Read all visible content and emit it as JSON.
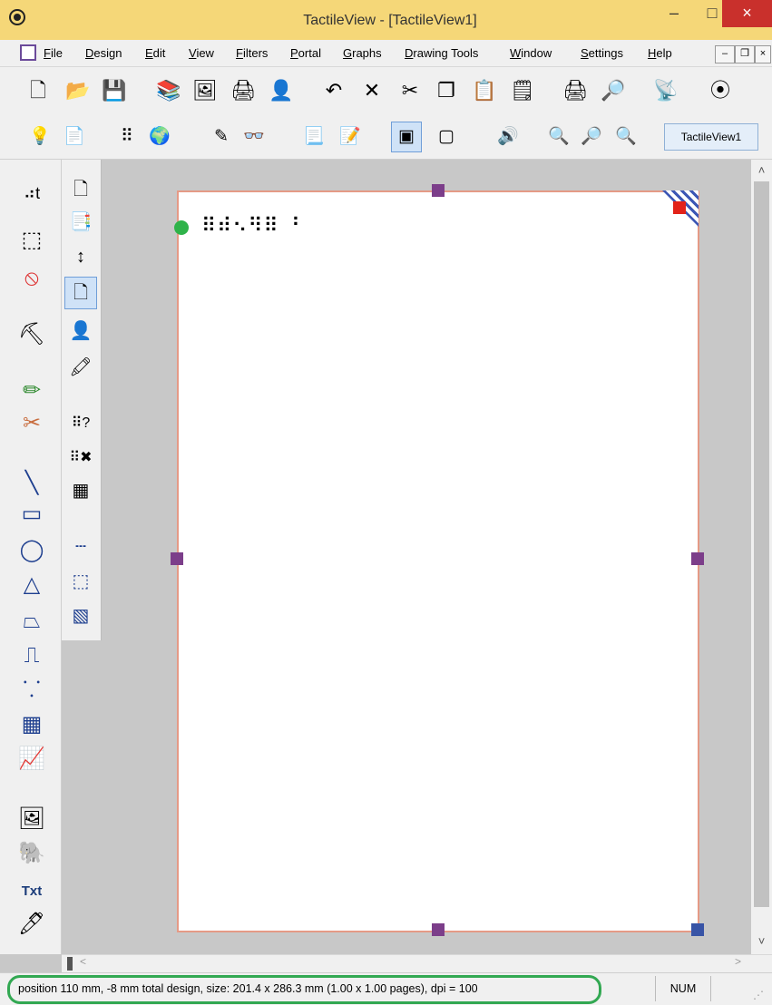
{
  "window": {
    "title": "TactileView - [TactileView1]",
    "buttons": {
      "minimize": "–",
      "maximize": "□",
      "close": "×"
    }
  },
  "menu": {
    "items": [
      "File",
      "Design",
      "Edit",
      "View",
      "Filters",
      "Portal",
      "Graphs",
      "Drawing Tools",
      "Window",
      "Settings",
      "Help"
    ],
    "mdi_buttons": [
      "–",
      "❐",
      "×"
    ]
  },
  "toolbar1": {
    "icons": [
      {
        "name": "new-document-icon",
        "glyph": "🗋"
      },
      {
        "name": "open-folder-icon",
        "glyph": "📂"
      },
      {
        "name": "save-icon",
        "glyph": "💾"
      },
      {
        "name": "library-icon",
        "glyph": "📚"
      },
      {
        "name": "image-library-icon",
        "glyph": "🖼"
      },
      {
        "name": "scanner-icon",
        "glyph": "🖨"
      },
      {
        "name": "person-icon",
        "glyph": "👤"
      },
      {
        "name": "undo-icon",
        "glyph": "↶"
      },
      {
        "name": "delete-icon",
        "glyph": "✕"
      },
      {
        "name": "cut-icon",
        "glyph": "✂"
      },
      {
        "name": "copy-icon",
        "glyph": "❐"
      },
      {
        "name": "paste-icon",
        "glyph": "📋"
      },
      {
        "name": "paste-special-icon",
        "glyph": "🗒"
      },
      {
        "name": "print-icon",
        "glyph": "🖨"
      },
      {
        "name": "print-preview-icon",
        "glyph": "🔎"
      },
      {
        "name": "rss-icon",
        "glyph": "📡"
      },
      {
        "name": "tactileview-icon",
        "glyph": "⦿"
      }
    ]
  },
  "toolbar2": {
    "icons": [
      {
        "name": "lightbulb-icon",
        "glyph": "💡"
      },
      {
        "name": "document-settings-icon",
        "glyph": "📄"
      },
      {
        "name": "braille-cells-icon",
        "glyph": "⠿"
      },
      {
        "name": "globe-icon",
        "glyph": "🌍"
      },
      {
        "name": "edit-pencil-icon",
        "glyph": "✎"
      },
      {
        "name": "proofread-icon",
        "glyph": "👓"
      },
      {
        "name": "page-list-icon",
        "glyph": "📃"
      },
      {
        "name": "page-edit-icon",
        "glyph": "📝"
      },
      {
        "name": "page-layout-icon",
        "glyph": "▣"
      },
      {
        "name": "page-portrait-icon",
        "glyph": "▢"
      },
      {
        "name": "speaker-icon",
        "glyph": "🔊"
      },
      {
        "name": "zoom-in-icon",
        "glyph": "🔍"
      },
      {
        "name": "zoom-out-icon",
        "glyph": "🔎"
      },
      {
        "name": "zoom-page-icon",
        "glyph": "🔍"
      }
    ],
    "document_tab": "TactileView1"
  },
  "tools_left": [
    {
      "name": "braille-text-tool-icon",
      "glyph": "⠴t"
    },
    {
      "name": "select-rectangle-icon",
      "glyph": "⬚"
    },
    {
      "name": "lasso-select-icon",
      "glyph": "⦸"
    },
    {
      "name": "fill-bucket-icon",
      "glyph": "⛏"
    },
    {
      "name": "pencil-tool-icon",
      "glyph": "✏"
    },
    {
      "name": "eraser-tool-icon",
      "glyph": "✂"
    },
    {
      "name": "line-tool-icon",
      "glyph": "╲"
    },
    {
      "name": "rectangle-tool-icon",
      "glyph": "▭"
    },
    {
      "name": "ellipse-tool-icon",
      "glyph": "◯"
    },
    {
      "name": "triangle-tool-icon",
      "glyph": "△"
    },
    {
      "name": "trapezoid-tool-icon",
      "glyph": "⏢"
    },
    {
      "name": "polyline-tool-icon",
      "glyph": "⎍"
    },
    {
      "name": "dots-tool-icon",
      "glyph": "⸪"
    },
    {
      "name": "table-tool-icon",
      "glyph": "▦"
    },
    {
      "name": "graph-tool-icon",
      "glyph": "📈"
    },
    {
      "name": "insert-image-icon",
      "glyph": "🖼"
    },
    {
      "name": "elephant-icon",
      "glyph": "🐘"
    },
    {
      "name": "txt-tool-icon",
      "glyph": "Txt"
    },
    {
      "name": "pipette-tool-icon",
      "glyph": "🖊"
    }
  ],
  "tools_second": [
    {
      "name": "page-zoom-icon",
      "glyph": "🗋"
    },
    {
      "name": "copy-page-icon",
      "glyph": "📑"
    },
    {
      "name": "page-size-icon",
      "glyph": "↕"
    },
    {
      "name": "page-select-icon",
      "glyph": "🗋"
    },
    {
      "name": "user-profile-icon",
      "glyph": "👤"
    },
    {
      "name": "color-markers-icon",
      "glyph": "🖍"
    },
    {
      "name": "braille-query-icon",
      "glyph": "⠿?"
    },
    {
      "name": "braille-delete-icon",
      "glyph": "⠿✖"
    },
    {
      "name": "grid-pattern-icon",
      "glyph": "▦"
    },
    {
      "name": "dashed-line-icon",
      "glyph": "┄"
    },
    {
      "name": "dashed-box-icon",
      "glyph": "⬚"
    },
    {
      "name": "hatch-pattern-icon",
      "glyph": "▧"
    }
  ],
  "canvas": {
    "braille_text": "⠿⠾⠢⠻⠿ ⠘"
  },
  "scroll": {
    "up": "˄",
    "down": "˅",
    "left": "<",
    "right": ">"
  },
  "status": {
    "text": "position 110 mm, -8 mm total design, size: 201.4 x 286.3 mm (1.00 x 1.00 pages), dpi = 100",
    "num": "NUM"
  },
  "colors": {
    "titlebar": "#f5d778",
    "close_button": "#c9302c",
    "page_border": "#e59a86",
    "handle": "#7c3e8a",
    "handle_blue": "#3854a6",
    "handle_red": "#e2231a",
    "origin_dot": "#2fb34a",
    "status_highlight": "#32a852"
  }
}
